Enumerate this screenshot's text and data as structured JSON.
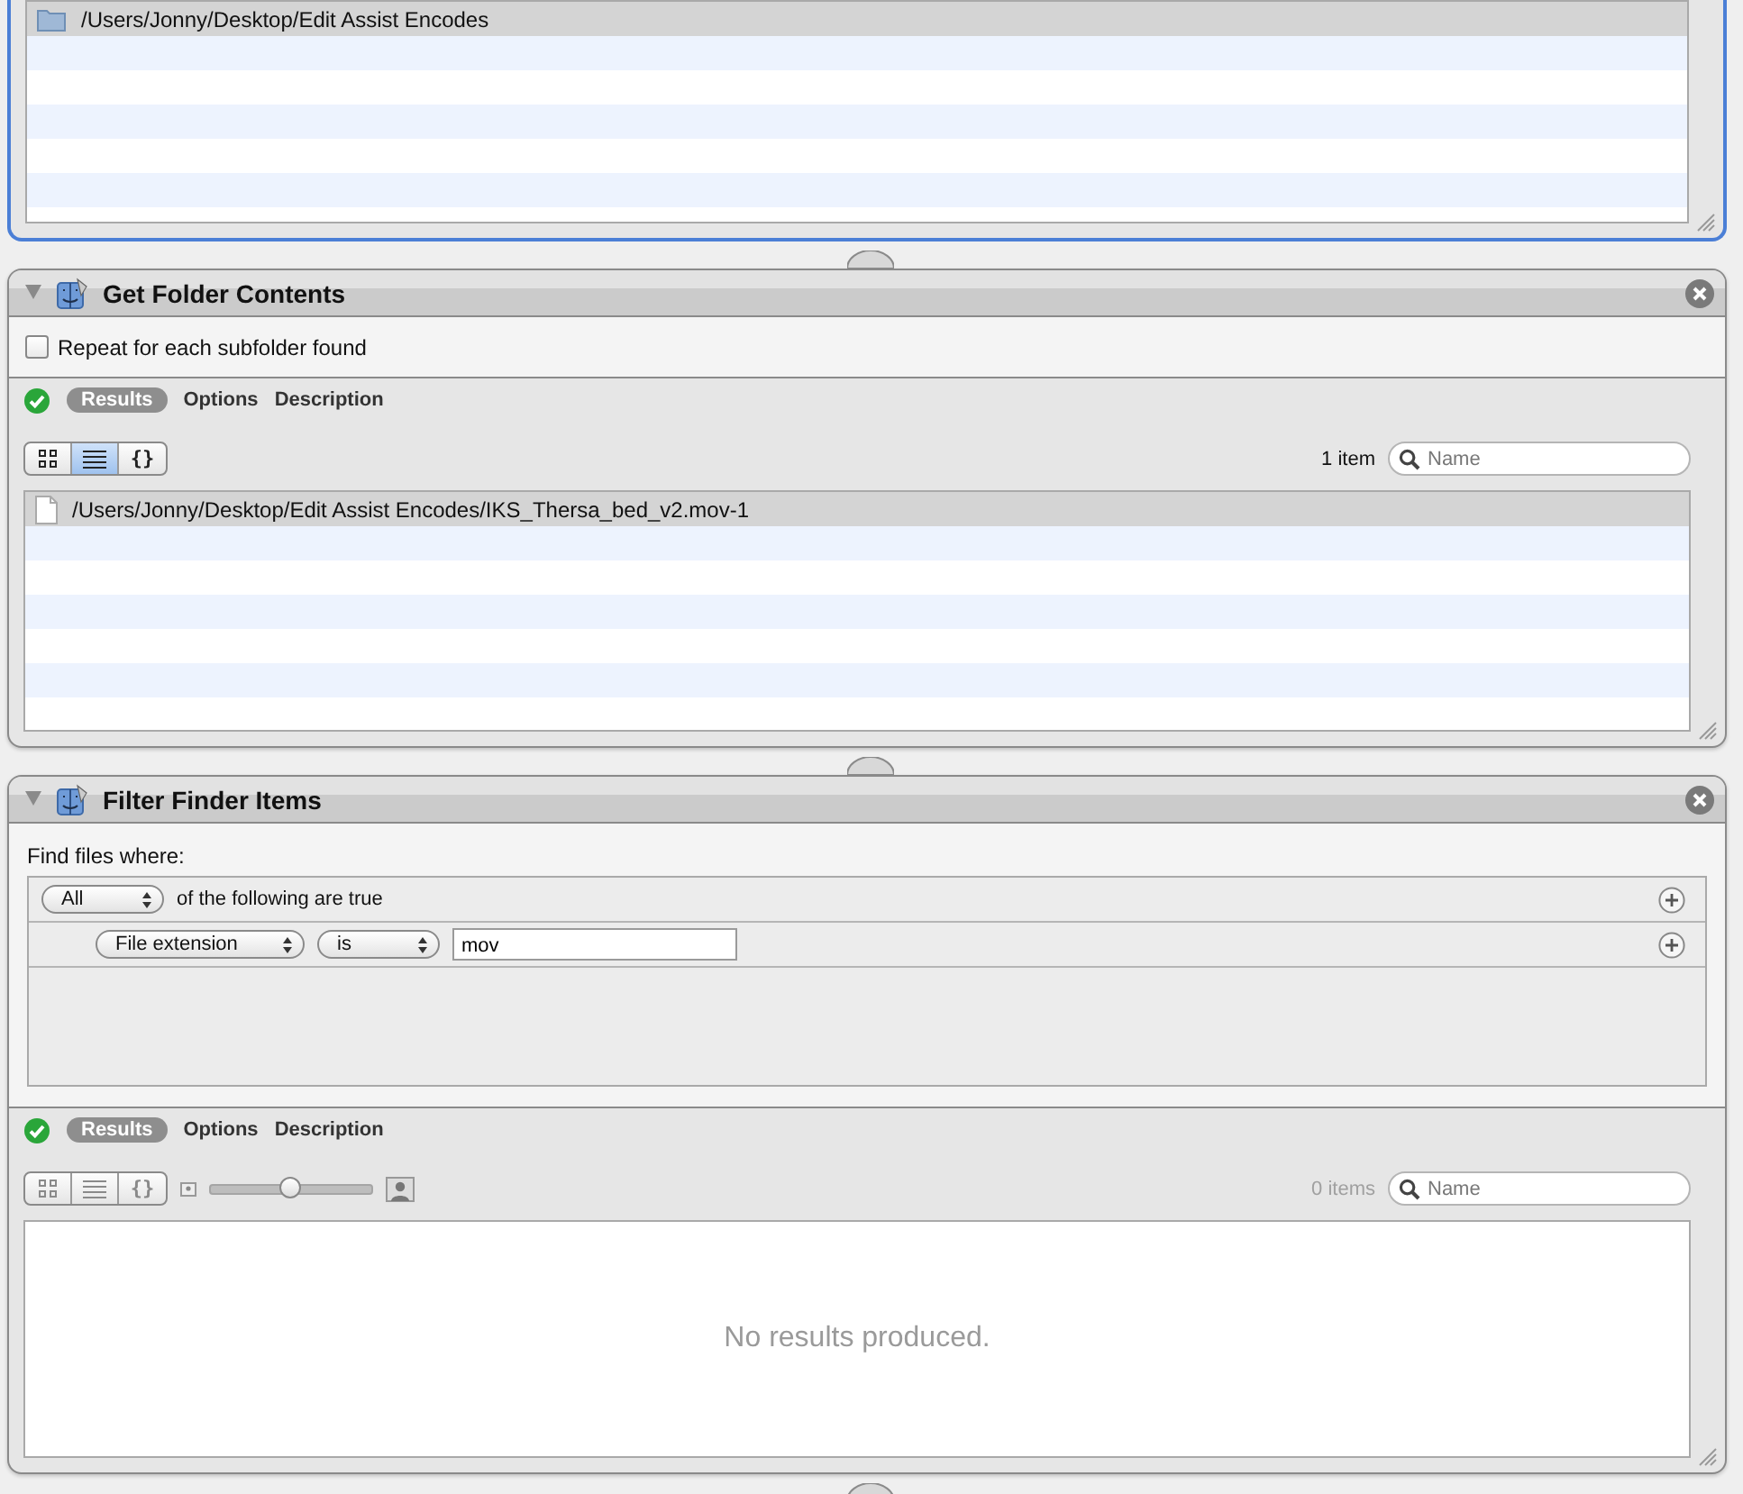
{
  "workflow": {
    "top_action": {
      "selected": true,
      "results": {
        "rows": [
          {
            "path": "/Users/Jonny/Desktop/Edit Assist Encodes",
            "kind": "folder",
            "selected": true
          }
        ]
      }
    },
    "actions": [
      {
        "title": "Get Folder Contents",
        "selected": false,
        "expanded": true,
        "options": {
          "kind": "checkboxes",
          "items": [
            {
              "label": "Repeat for each subfolder found",
              "checked": false
            }
          ]
        },
        "results": {
          "succeeded": true,
          "enabled": true,
          "tabs": [
            {
              "label": "Results",
              "selected": true
            },
            {
              "label": "Options",
              "selected": false
            },
            {
              "label": "Description",
              "selected": false
            }
          ],
          "view_buttons": [
            {
              "kind": "grid",
              "selected": false
            },
            {
              "kind": "list",
              "selected": true
            },
            {
              "kind": "braces",
              "label": "{}",
              "selected": false
            }
          ],
          "count": "1 item",
          "search": {
            "placeholder": "Name"
          },
          "rows": [
            {
              "path": "/Users/Jonny/Desktop/Edit Assist Encodes/IKS_Thersa_bed_v2.mov-1",
              "kind": "file",
              "selected": true
            }
          ]
        }
      },
      {
        "title": "Filter Finder Items",
        "selected": false,
        "expanded": true,
        "options": {
          "kind": "filter",
          "label": "Find files where:",
          "criteria": [
            {
              "kind": "match",
              "popups": [
                "All"
              ],
              "text": "of the following are true"
            },
            {
              "kind": "condition",
              "popups": [
                "File extension",
                "is"
              ],
              "value": "mov"
            }
          ]
        },
        "results": {
          "succeeded": true,
          "enabled": false,
          "tabs": [
            {
              "label": "Results",
              "selected": true
            },
            {
              "label": "Options",
              "selected": false
            },
            {
              "label": "Description",
              "selected": false
            }
          ],
          "view_buttons": [
            {
              "kind": "grid",
              "selected": false
            },
            {
              "kind": "list",
              "selected": false
            },
            {
              "kind": "braces",
              "label": "{}",
              "selected": false
            }
          ],
          "slider": {
            "level": 0.49
          },
          "count": "0 items",
          "search": {
            "placeholder": "Name"
          },
          "empty_message": "No results produced."
        }
      }
    ]
  }
}
